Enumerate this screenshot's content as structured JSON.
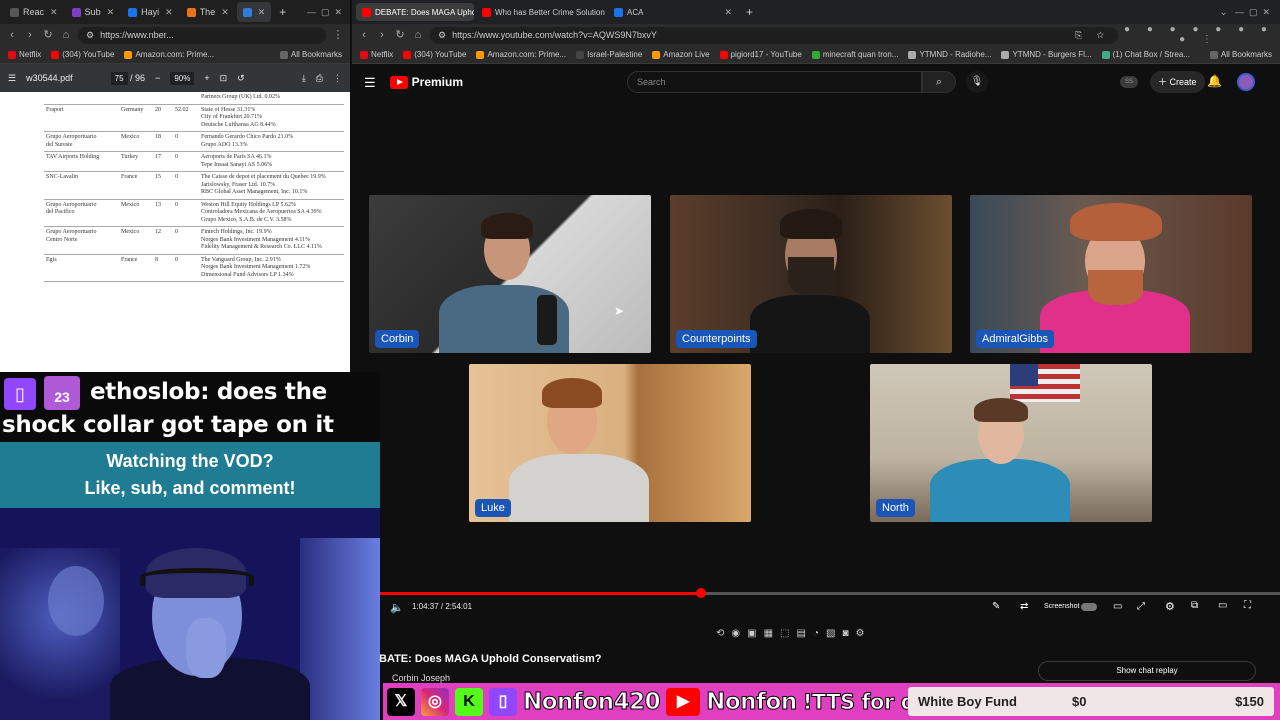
{
  "left_browser": {
    "tabs": [
      {
        "label": "Reac",
        "color": "#555555"
      },
      {
        "label": "Sub",
        "color": "#7b3fbf"
      },
      {
        "label": "Hayi",
        "color": "#1a73e8"
      },
      {
        "label": "The",
        "color": "#e8711a"
      },
      {
        "label": "",
        "color": "#2e7dd7"
      }
    ],
    "url": "https://www.nber...",
    "bookmarks": [
      "Netflix",
      "(304) YouTube",
      "Amazon.com: Prime...",
      "All Bookmarks"
    ],
    "pdf": {
      "filename": "w30544.pdf",
      "page_current": "75",
      "page_total": "/ 96",
      "zoom": "90%",
      "rows": [
        {
          "name": "",
          "country": "",
          "n": "",
          "v": "",
          "owners": "Partners Group (UK) Ltd. 0.02%"
        },
        {
          "name": "Fraport",
          "country": "Germany",
          "n": "20",
          "v": "52.02",
          "owners": "State of Hesse 31.31%\nCity of Frankfurt 20.71%\nDeutsche Lufthansa AG 8.44%"
        },
        {
          "name": "Grupo Aeroportuario\ndel Sureste",
          "country": "Mexico",
          "n": "18",
          "v": "0",
          "owners": "Fernando Gerardo Chico Pardo 21.0%\nGrupo ADO 13.3%"
        },
        {
          "name": "TAV Airports Holding",
          "country": "Turkey",
          "n": "17",
          "v": "0",
          "owners": "Aeroports de Paris SA 46.1%\nTepe Insaat Sanayi AS 5.06%"
        },
        {
          "name": "SNC-Lavalin",
          "country": "France",
          "n": "15",
          "v": "0",
          "owners": "The Caisse de depot et placement du Quebec 19.9%\nJarislowsky, Fraser Ltd. 10.7%\nRBC Global Asset Management, Inc. 10.1%"
        },
        {
          "name": "Grupo Aeroportuario\ndel Pacifico",
          "country": "Mexico",
          "n": "13",
          "v": "0",
          "owners": "Weston Hill Equity Holdings LP 5.62%\nControladora Mexicana de Aeropuertos SA 4.39%\nGrupo Mexico, S.A.B. de C.V. 3.58%"
        },
        {
          "name": "Grupo Aeroportuario\nCentro Norte",
          "country": "Mexico",
          "n": "12",
          "v": "0",
          "owners": "Fintech Holdings, Inc. 19.9%\nNorges Bank Investment Management 4.11%\nFidelity Management & Research Co. LLC 4.11%"
        },
        {
          "name": "Egis",
          "country": "France",
          "n": "8",
          "v": "0",
          "owners": "The Vanguard Group, Inc. 2.91%\nNorges Bank Investment Management 1.72%\nDimensional Fund Advisors LP 1.34%"
        }
      ]
    }
  },
  "right_browser": {
    "tabs": [
      {
        "label": "DEBATE: Does MAGA Uphol",
        "color": "#ff0000",
        "active": true
      },
      {
        "label": "Who has Better Crime Solution",
        "color": "#ff0000",
        "active": false
      },
      {
        "label": "ACA",
        "color": "#1a73e8",
        "active": false
      }
    ],
    "url": "https://www.youtube.com/watch?v=AQWS9N7bxvY",
    "bookmarks": [
      "Netflix",
      "(304) YouTube",
      "Amazon.com: Prime...",
      "Israel-Palestine",
      "Amazon Live",
      "pigiord17 - YouTube",
      "minecraft quan tron...",
      "YTMND - Radiohe...",
      "YTMND - Burgers Fl...",
      "(1) Chat Box / Strea...",
      "All Bookmarks"
    ],
    "youtube": {
      "brand": "Premium",
      "search_placeholder": "Search",
      "create_label": "Create",
      "participants": [
        "Corbin",
        "Counterpoints",
        "AdmiralGibbs",
        "Luke",
        "North"
      ],
      "time": "1:04:37 / 2:54:01",
      "progress": 0.3565,
      "screenshot_label": "Screenshot",
      "video_title": "BATE: Does MAGA Uphold Conservatism?",
      "channel": "Corbin Joseph",
      "chat_replay": "Show chat replay"
    }
  },
  "overlay": {
    "chat_user": "ethoslob:",
    "chat_msg_1": "does the",
    "chat_msg_2": "shock collar got tape on it",
    "badge_number": "23",
    "vod_line1": "Watching the VOD?",
    "vod_line2": "Like, sub, and comment!",
    "social": {
      "handle1": "Nonfon420",
      "handle2": "Nonfon",
      "tts": "!TTS for dono link"
    },
    "goal": {
      "label": "White Boy Fund",
      "current": "$0",
      "target": "$150",
      "progress": 0
    }
  }
}
